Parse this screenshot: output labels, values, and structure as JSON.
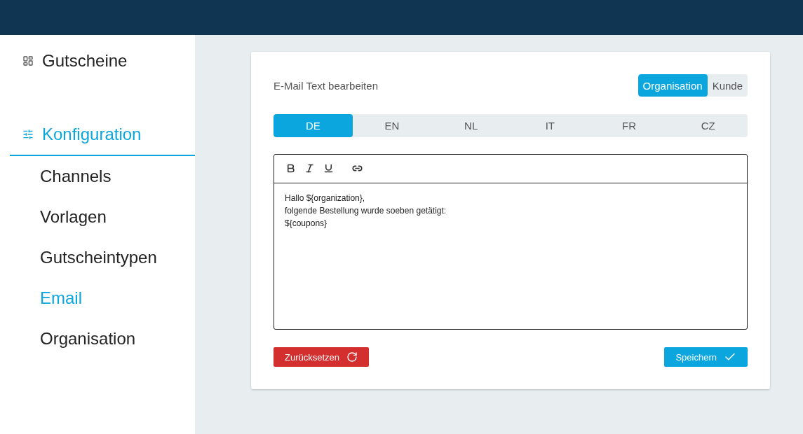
{
  "sidebar": {
    "sections": [
      {
        "label": "Gutscheine",
        "kind": "dashboard",
        "selected": false
      },
      {
        "label": "Konfiguration",
        "kind": "settings",
        "selected": true,
        "children": [
          {
            "label": "Channels",
            "selected": false
          },
          {
            "label": "Vorlagen",
            "selected": false
          },
          {
            "label": "Gutscheintypen",
            "selected": false
          },
          {
            "label": "Email",
            "selected": true
          },
          {
            "label": "Organisation",
            "selected": false
          }
        ]
      }
    ]
  },
  "card": {
    "title": "E-Mail Text bearbeiten",
    "recipient_toggle": [
      {
        "label": "Organisation",
        "selected": true
      },
      {
        "label": "Kunde",
        "selected": false
      }
    ],
    "language_tabs": [
      {
        "label": "DE",
        "selected": true
      },
      {
        "label": "EN",
        "selected": false
      },
      {
        "label": "NL",
        "selected": false
      },
      {
        "label": "IT",
        "selected": false
      },
      {
        "label": "FR",
        "selected": false
      },
      {
        "label": "CZ",
        "selected": false
      }
    ],
    "editor": {
      "toolbar": [
        {
          "kind": "bold"
        },
        {
          "kind": "italic"
        },
        {
          "kind": "underline"
        },
        {
          "kind": "link"
        }
      ],
      "lines": [
        "Hallo ${organization},",
        "folgende Bestellung wurde soeben getätigt:",
        "${coupons}"
      ]
    },
    "buttons": [
      {
        "label": "Zurücksetzen",
        "kind": "reset"
      },
      {
        "label": "Speichern",
        "kind": "save"
      }
    ]
  }
}
